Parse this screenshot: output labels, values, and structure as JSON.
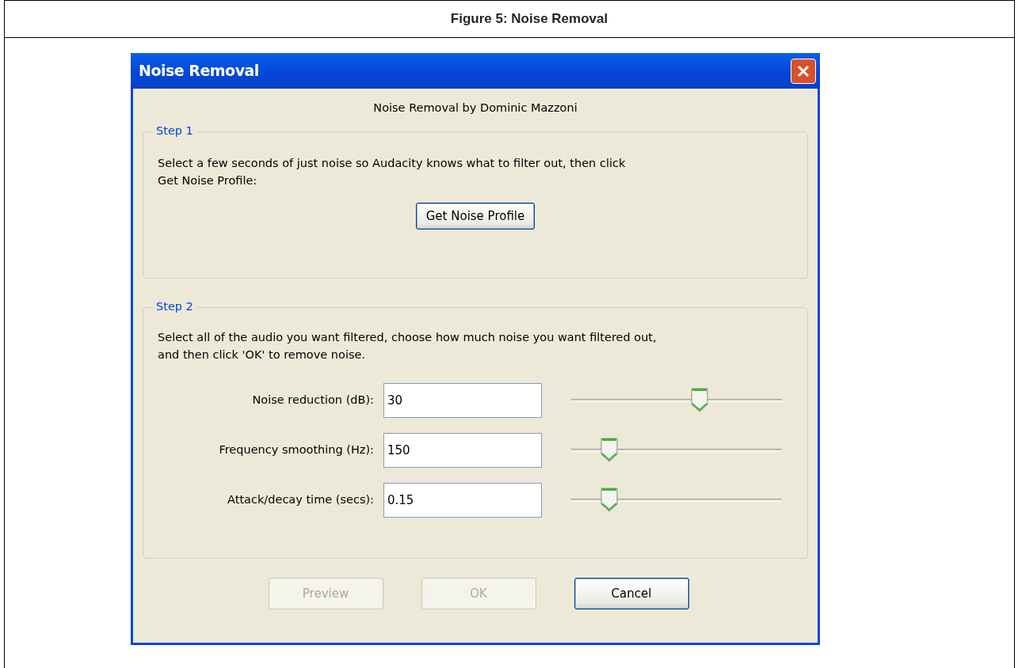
{
  "figure_caption": "Figure 5: Noise Removal",
  "window": {
    "title": "Noise Removal"
  },
  "subtitle": "Noise Removal by Dominic Mazzoni",
  "step1": {
    "legend": "Step 1",
    "text": "Select a few seconds of just noise so Audacity knows what to filter out, then click Get Noise Profile:",
    "button": "Get Noise Profile"
  },
  "step2": {
    "legend": "Step 2",
    "text": "Select all of the audio you want filtered, choose how much noise you want filtered out, and then click 'OK' to remove noise.",
    "settings": [
      {
        "label": "Noise reduction (dB):",
        "value": "30",
        "level": 0.61
      },
      {
        "label": "Frequency smoothing (Hz):",
        "value": "150",
        "level": 0.18
      },
      {
        "label": "Attack/decay time (secs):",
        "value": "0.15",
        "level": 0.18
      }
    ]
  },
  "buttons": [
    {
      "label": "Preview",
      "disabled": true,
      "default": false
    },
    {
      "label": "OK",
      "disabled": true,
      "default": false
    },
    {
      "label": "Cancel",
      "disabled": false,
      "default": true
    }
  ]
}
